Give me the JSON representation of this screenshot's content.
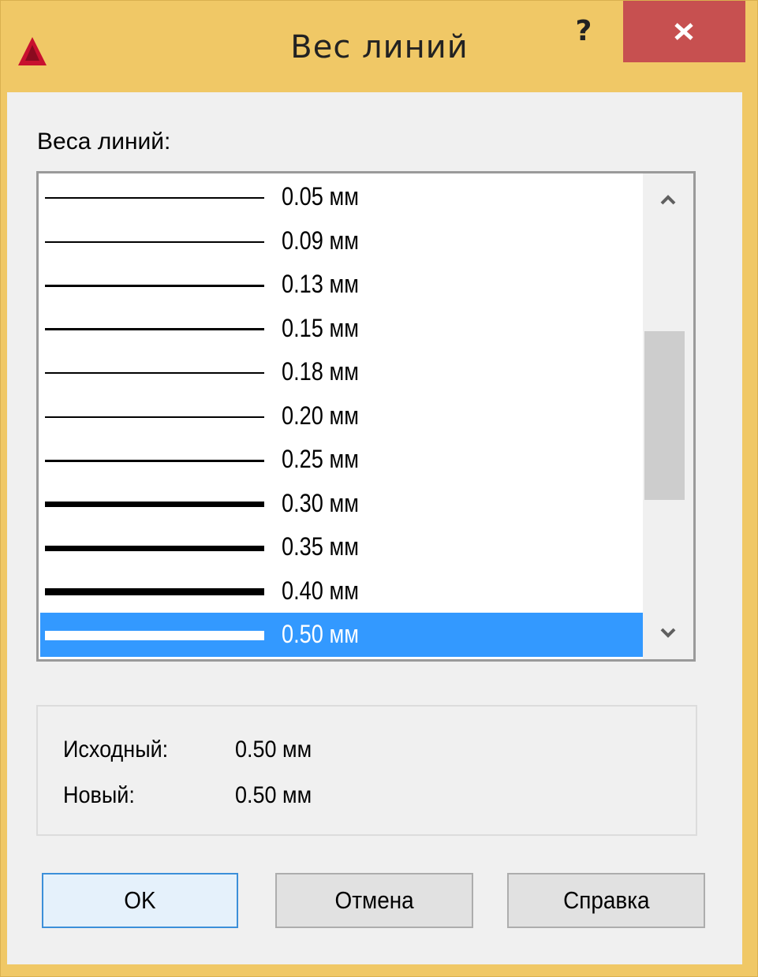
{
  "window": {
    "title": "Вес линий",
    "help_label": "?",
    "accent_color": "#f0c866",
    "close_color": "#c75050"
  },
  "list": {
    "label": "Веса линий:",
    "items": [
      {
        "label": "0.05 мм"
      },
      {
        "label": "0.09 мм"
      },
      {
        "label": "0.13 мм"
      },
      {
        "label": "0.15 мм"
      },
      {
        "label": "0.18 мм"
      },
      {
        "label": "0.20 мм"
      },
      {
        "label": "0.25 мм"
      },
      {
        "label": "0.30 мм"
      },
      {
        "label": "0.35 мм"
      },
      {
        "label": "0.40 мм"
      },
      {
        "label": "0.50 мм",
        "selected": true
      }
    ],
    "selection_color": "#3399ff"
  },
  "info": {
    "original_label": "Исходный:",
    "original_value": "0.50 мм",
    "new_label": "Новый:",
    "new_value": "0.50 мм"
  },
  "buttons": {
    "ok": "OK",
    "cancel": "Отмена",
    "help": "Справка"
  },
  "icons": {
    "app": "autocad-logo-icon",
    "close": "close-icon",
    "scroll_up": "chevron-up-icon",
    "scroll_down": "chevron-down-icon"
  }
}
